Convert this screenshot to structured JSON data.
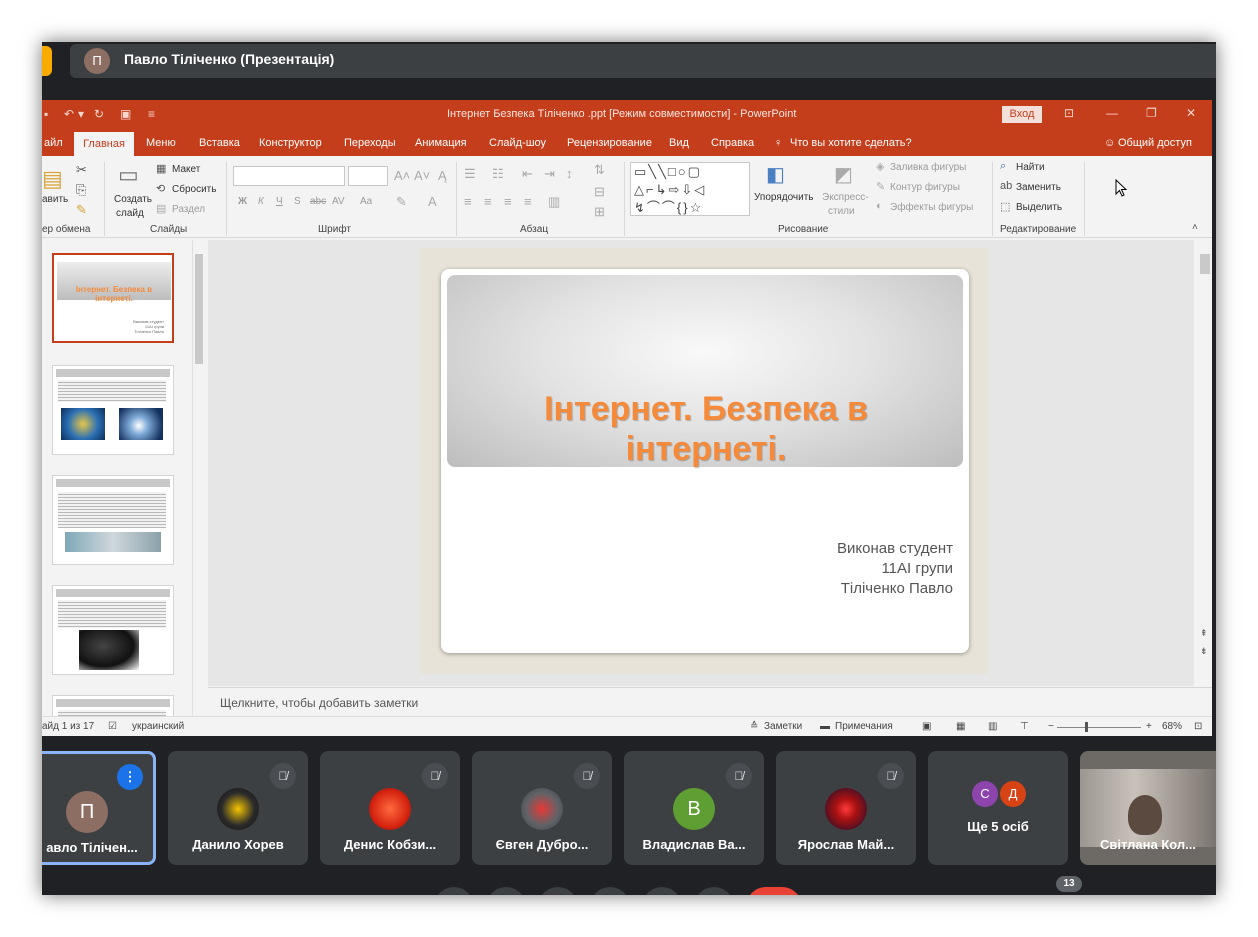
{
  "meet": {
    "presenter_initial": "П",
    "presenter_title": "Павло Тіліченко (Презентація)",
    "participant_count": "13"
  },
  "ppt": {
    "window_title": "Інтернет Безпека Тіліченко .ppt [Режим совместимости] - PowerPoint",
    "login_button": "Вход",
    "share_button": "Общий доступ",
    "tell_me": "Что вы хотите сделать?",
    "menu": {
      "file": "айл",
      "home": "Главная",
      "menu": "Меню",
      "insert": "Вставка",
      "design": "Конструктор",
      "transitions": "Переходы",
      "animation": "Анимация",
      "slideshow": "Слайд-шоу",
      "review": "Рецензирование",
      "view": "Вид",
      "help": "Справка"
    },
    "ribbon": {
      "paste": "авить",
      "clipboard_group": "ер обмена",
      "new_slide": "Создать",
      "new_slide_2": "слайд",
      "layout": "Макет",
      "reset": "Сбросить",
      "section": "Раздел",
      "slides_group": "Слайды",
      "font_group": "Шрифт",
      "bold": "Ж",
      "italic": "К",
      "underline": "Ч",
      "strike": "S",
      "font_abc": "abc",
      "char_spacing": "AV",
      "case": "Aa",
      "paragraph_group": "Абзац",
      "arrange": "Упорядочить",
      "quick_styles": "Экспресс-",
      "quick_styles_2": "стили",
      "shape_fill": "Заливка фигуры",
      "shape_outline": "Контур фигуры",
      "shape_effects": "Эффекты фигуры",
      "drawing_group": "Рисование",
      "find": "Найти",
      "replace": "Заменить",
      "select": "Выделить",
      "editing_group": "Редактирование"
    },
    "thumbnails": [
      {
        "title": "Інтернет. Безпека в інтернеті.",
        "sub1": "Виконав студент",
        "sub2": "11АІ групи",
        "sub3": "Тіліченко Павло"
      }
    ],
    "slide": {
      "title_line1": "Інтернет. Безпека в",
      "title_line2": "інтернеті.",
      "subtitle_line1": "Виконав студент",
      "subtitle_line2": "11АІ групи",
      "subtitle_line3": "Тіліченко Павло"
    },
    "notes_placeholder": "Щелкните, чтобы добавить заметки",
    "status": {
      "slide_counter": "айд 1 из 17",
      "language": "украинский",
      "notes": "Заметки",
      "comments": "Примечания",
      "zoom": "68%"
    }
  },
  "participants": [
    {
      "initial": "П",
      "name": "авло Тілічен..."
    },
    {
      "name": "Данило Хорев"
    },
    {
      "name": "Денис Кобзи..."
    },
    {
      "name": "Євген Дубро..."
    },
    {
      "initial": "В",
      "name": "Владислав Ва..."
    },
    {
      "name": "Ярослав Май..."
    },
    {
      "name": "Ще 5 осіб",
      "initials": [
        "С",
        "Д"
      ]
    },
    {
      "name": "Світлана Кол..."
    }
  ],
  "colors": {
    "ppt_accent": "#c43e1c",
    "slide_title": "#f58a3a",
    "meet_bg": "#202124",
    "speaking": "#1a73e8"
  }
}
